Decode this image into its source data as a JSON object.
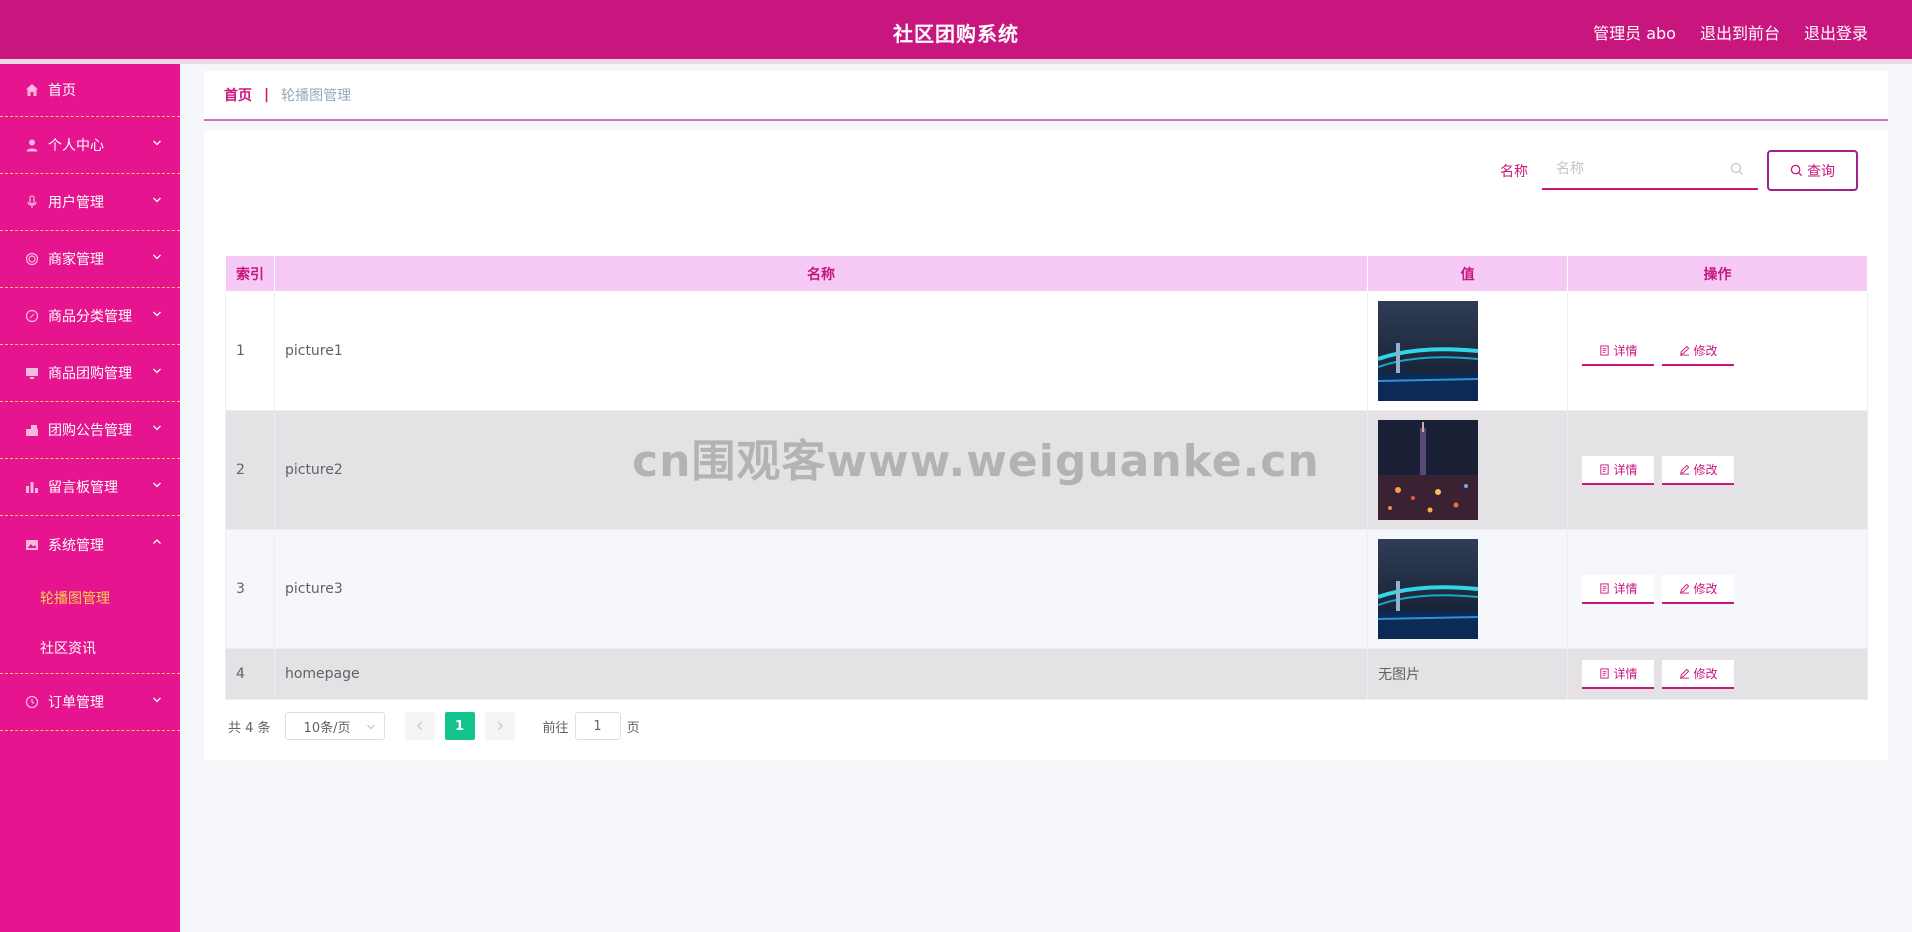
{
  "header": {
    "title": "社区团购系统",
    "admin": "管理员 abo",
    "to_front": "退出到前台",
    "logout": "退出登录"
  },
  "sidebar": {
    "items": [
      {
        "label": "首页",
        "icon": "home-icon"
      },
      {
        "label": "个人中心",
        "icon": "user-icon"
      },
      {
        "label": "用户管理",
        "icon": "mic-icon"
      },
      {
        "label": "商家管理",
        "icon": "store-icon"
      },
      {
        "label": "商品分类管理",
        "icon": "compass-icon"
      },
      {
        "label": "商品团购管理",
        "icon": "monitor-icon"
      },
      {
        "label": "团购公告管理",
        "icon": "printer-icon"
      },
      {
        "label": "留言板管理",
        "icon": "bar-chart-icon"
      },
      {
        "label": "系统管理",
        "icon": "picture-icon"
      },
      {
        "label": "订单管理",
        "icon": "clock-icon"
      }
    ],
    "sub_items": [
      "轮播图管理",
      "社区资讯"
    ]
  },
  "breadcrumb": {
    "home": "首页",
    "sep": "|",
    "current": "轮播图管理"
  },
  "search": {
    "label": "名称",
    "placeholder": "名称",
    "button": "查询"
  },
  "table": {
    "headers": [
      "索引",
      "名称",
      "值",
      "操作"
    ],
    "rows": [
      {
        "index": "1",
        "name": "picture1",
        "value": ""
      },
      {
        "index": "2",
        "name": "picture2",
        "value": ""
      },
      {
        "index": "3",
        "name": "picture3",
        "value": ""
      },
      {
        "index": "4",
        "name": "homepage",
        "value": "无图片"
      }
    ],
    "detail": "详情",
    "edit": "修改"
  },
  "pager": {
    "total": "共 4 条",
    "size": "10条/页",
    "current": "1",
    "goto": "前往",
    "goto_value": "1",
    "page": "页"
  },
  "watermark": "cn围观客www.weiguanke.cn",
  "colors": {
    "primary": "#c9167f",
    "sidebar": "#e6158f",
    "accent": "#f6d34a",
    "page_active": "#13c38d"
  }
}
